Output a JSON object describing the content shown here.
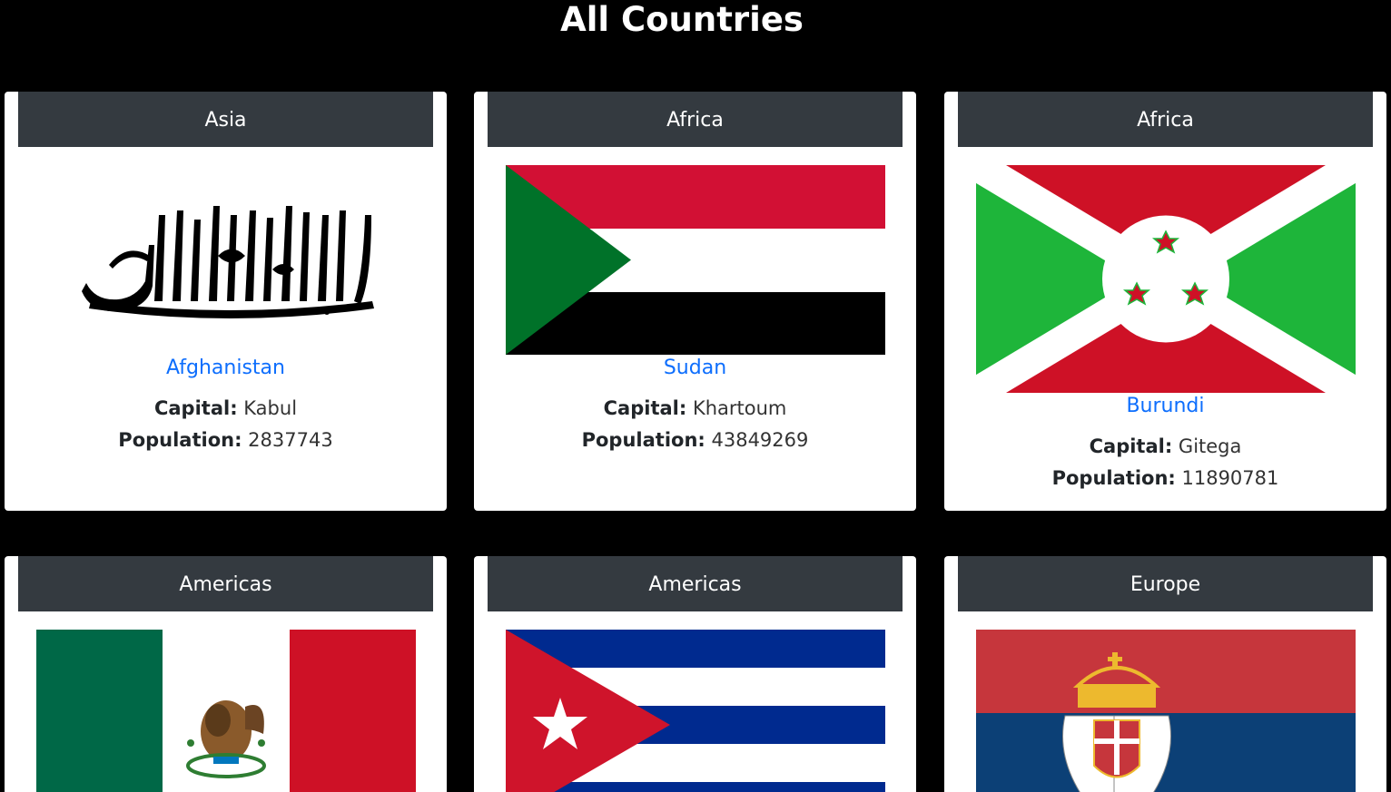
{
  "page": {
    "title": "All Countries"
  },
  "countries": [
    {
      "region": "Asia",
      "name": "Afghanistan",
      "capital": "Kabul",
      "population": "2837743",
      "flag": "afghanistan-flag-icon"
    },
    {
      "region": "Africa",
      "name": "Sudan",
      "capital": "Khartoum",
      "population": "43849269",
      "flag": "sudan-flag-icon"
    },
    {
      "region": "Africa",
      "name": "Burundi",
      "capital": "Gitega",
      "population": "11890781",
      "flag": "burundi-flag-icon"
    },
    {
      "region": "Americas",
      "name": "",
      "capital": "",
      "population": "",
      "flag": "mexico-flag-icon"
    },
    {
      "region": "Americas",
      "name": "",
      "capital": "",
      "population": "",
      "flag": "cuba-flag-icon"
    },
    {
      "region": "Europe",
      "name": "",
      "capital": "",
      "population": "",
      "flag": "serbia-flag-icon"
    }
  ],
  "labels": {
    "capital": "Capital:",
    "population": "Population:"
  },
  "colors": {
    "background": "#000000",
    "header": "#343a40",
    "link": "#0d6efd"
  }
}
